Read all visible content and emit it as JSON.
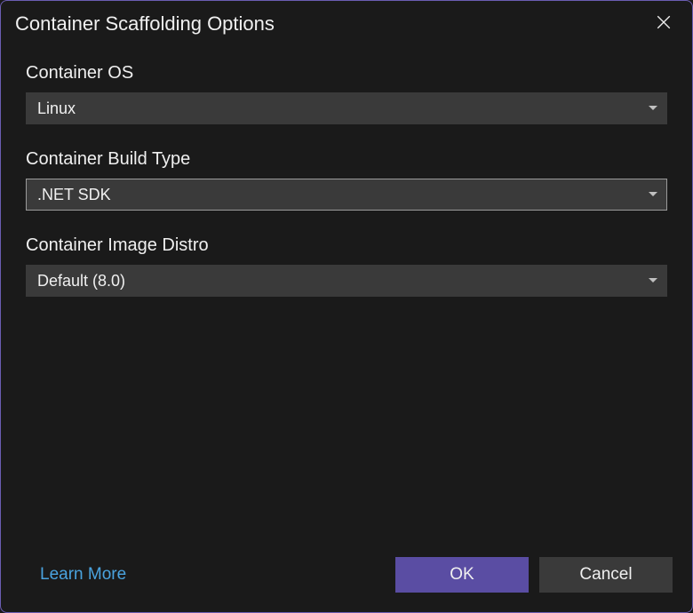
{
  "dialog": {
    "title": "Container Scaffolding Options"
  },
  "fields": {
    "os": {
      "label": "Container OS",
      "value": "Linux"
    },
    "buildType": {
      "label": "Container Build Type",
      "value": ".NET SDK"
    },
    "imageDistro": {
      "label": "Container Image Distro",
      "value": "Default (8.0)"
    }
  },
  "footer": {
    "learnMore": "Learn More",
    "ok": "OK",
    "cancel": "Cancel"
  }
}
